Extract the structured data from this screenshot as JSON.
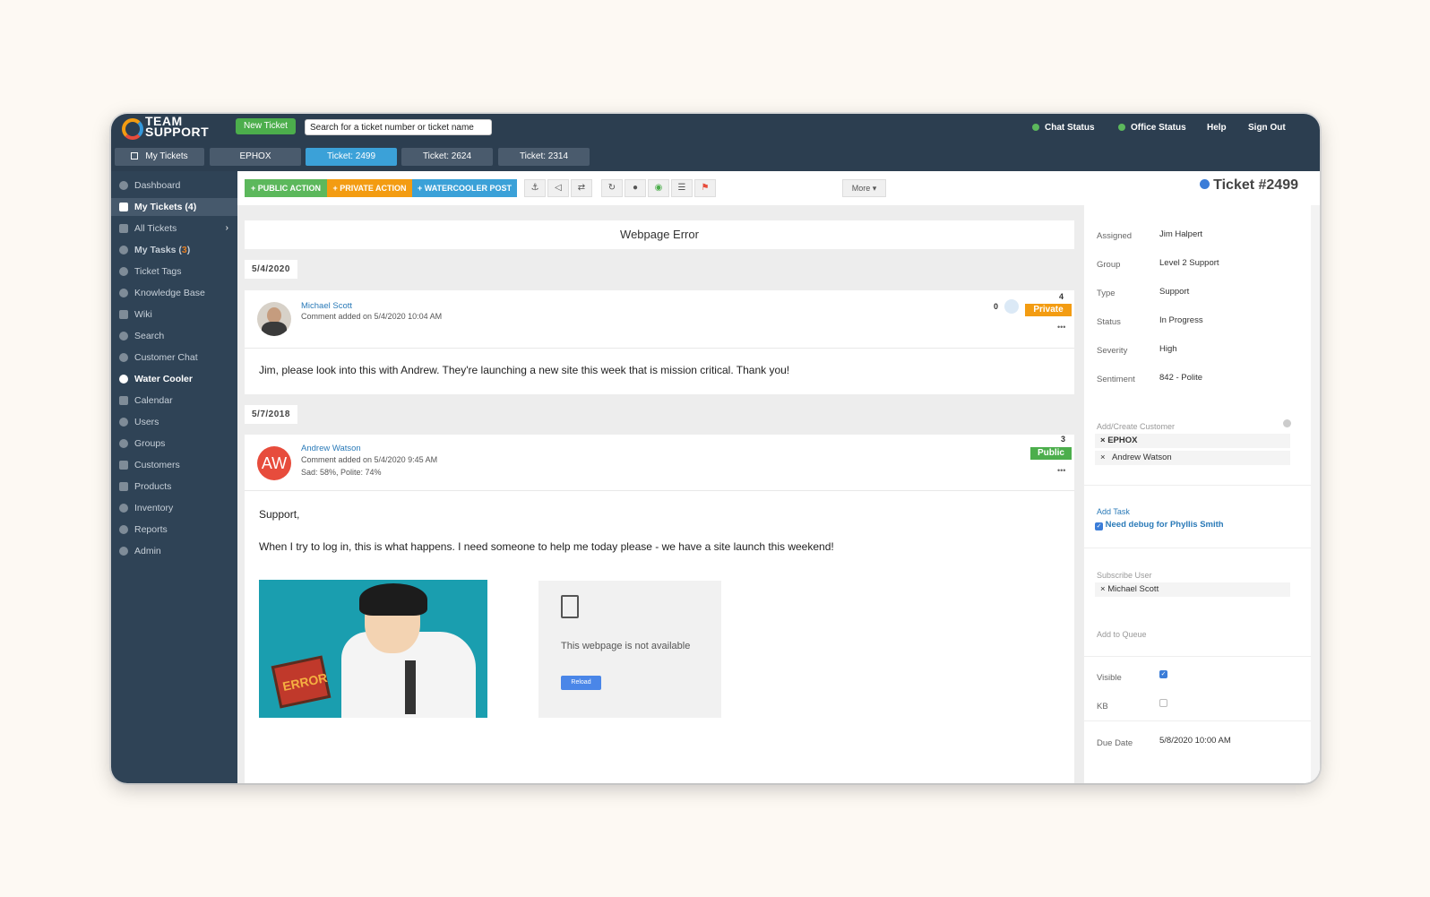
{
  "header": {
    "logo_line1": "TEAM",
    "logo_line2": "SUPPORT",
    "new_ticket_label": "New Ticket",
    "search_placeholder": "Search for a ticket number or ticket name",
    "chat_status": "Chat Status",
    "office_status": "Office Status",
    "help": "Help",
    "sign_out": "Sign Out"
  },
  "tabs": [
    {
      "label": "My Tickets"
    },
    {
      "label": "EPHOX"
    },
    {
      "label": "Ticket: 2499"
    },
    {
      "label": "Ticket: 2624"
    },
    {
      "label": "Ticket: 2314"
    }
  ],
  "sidebar": {
    "items": [
      {
        "label": "Dashboard"
      },
      {
        "label": "My Tickets (4)"
      },
      {
        "label": "All Tickets"
      },
      {
        "label": "My Tasks ("
      },
      {
        "label": "Ticket Tags"
      },
      {
        "label": "Knowledge Base"
      },
      {
        "label": "Wiki"
      },
      {
        "label": "Search"
      },
      {
        "label": "Customer Chat"
      },
      {
        "label": "Water Cooler"
      },
      {
        "label": "Calendar"
      },
      {
        "label": "Users"
      },
      {
        "label": "Groups"
      },
      {
        "label": "Customers"
      },
      {
        "label": "Products"
      },
      {
        "label": "Inventory"
      },
      {
        "label": "Reports"
      },
      {
        "label": "Admin"
      }
    ],
    "task_count": "3",
    "task_suffix": ")"
  },
  "toolbar": {
    "public_action": "+ PUBLIC ACTION",
    "private_action": "+ PRIVATE ACTION",
    "watercooler_post": "+ WATERCOOLER POST",
    "more": "More ▾"
  },
  "ticket": {
    "subject": "Webpage Error",
    "number": "Ticket #2499"
  },
  "comments": [
    {
      "date": "5/4/2020",
      "author": "Michael Scott",
      "meta": "Comment added on 5/4/2020 10:04 AM",
      "count": "0",
      "top_count": "4",
      "badge": "Private",
      "ellipsis": "•••",
      "body": "Jim, please look into this with Andrew.  They're launching a new site this week that is mission critical. Thank you!"
    },
    {
      "date": "5/7/2018",
      "author": "Andrew Watson",
      "initials": "AW",
      "meta": "Comment added on 5/4/2020 9:45 AM",
      "sentiment": "Sad: 58%, Polite: 74%",
      "top_count": "3",
      "badge": "Public",
      "ellipsis": "•••",
      "greeting": "Support,",
      "body": "When I try to log in, this is what happens.  I need someone to help me today please - we have a site launch this weekend!",
      "error_sign": "ERROR",
      "unavailable_text": "This webpage is not available",
      "reload": "Reload"
    }
  ],
  "properties": [
    {
      "label": "Assigned",
      "value": "Jim Halpert"
    },
    {
      "label": "Group",
      "value": "Level 2 Support"
    },
    {
      "label": "Type",
      "value": "Support"
    },
    {
      "label": "Status",
      "value": "In Progress"
    },
    {
      "label": "Severity",
      "value": "High"
    },
    {
      "label": "Sentiment",
      "value": "842 - Polite"
    }
  ],
  "customers": {
    "label": "Add/Create Customer",
    "items": [
      "EPHOX",
      "Andrew Watson"
    ]
  },
  "tasks": {
    "label": "Add Task",
    "items": [
      "Need debug for Phyllis Smith"
    ]
  },
  "subscribe": {
    "label": "Subscribe User",
    "items": [
      "Michael Scott"
    ]
  },
  "queue": {
    "label": "Add to Queue"
  },
  "flags": [
    {
      "label": "Visible",
      "checked": true
    },
    {
      "label": "KB",
      "checked": false
    }
  ],
  "due_date": {
    "label": "Due Date",
    "value": "5/8/2020 10:00 AM"
  },
  "colors": {
    "topbar": "#2c3e50",
    "sidebar": "#2f4356",
    "active_tab": "#3ba1d8",
    "public_action": "#5cb85c",
    "private_action": "#f39c12",
    "watercooler": "#3ba1d8",
    "private_badge": "#f39c12",
    "public_badge": "#4cae4c",
    "avatar_aw": "#e74c3c"
  }
}
